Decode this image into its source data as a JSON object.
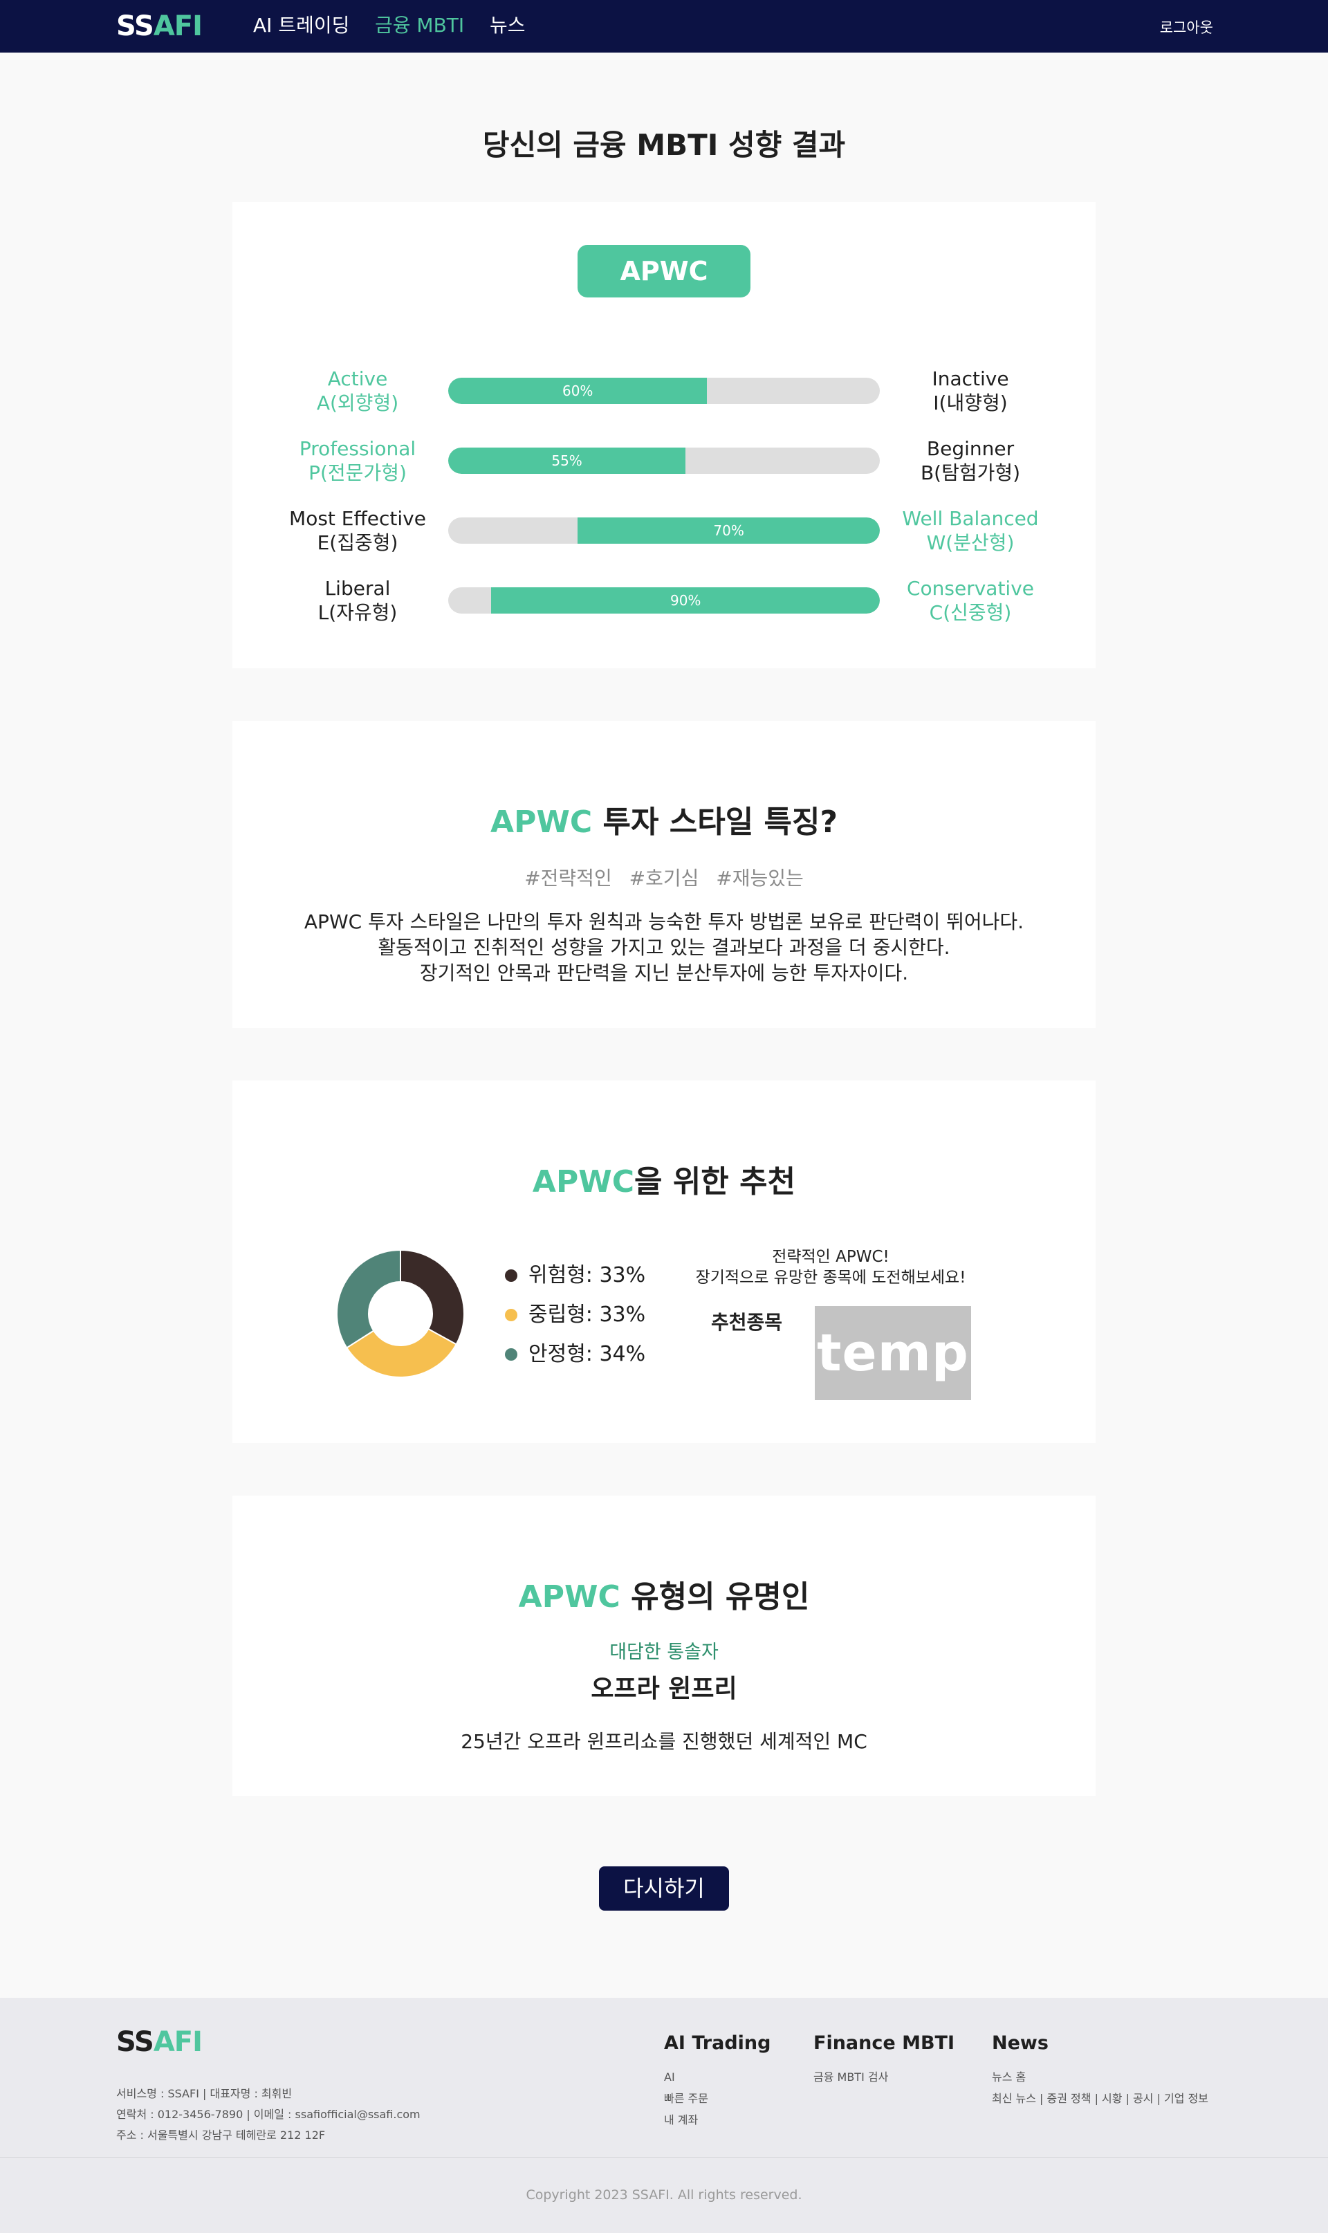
{
  "nav": {
    "logo_main": "SS",
    "logo_accent": "AFI",
    "links": [
      "AI 트레이딩",
      "금융 MBTI",
      "뉴스"
    ],
    "logout": "로그아웃"
  },
  "page_title": "당신의 금융 MBTI 성향 결과",
  "result": {
    "type": "APWC",
    "traits": [
      {
        "left_en": "Active",
        "left_ko": "A(외향형)",
        "right_en": "Inactive",
        "right_ko": "I(내향형)",
        "percent": 60,
        "percent_label": "60%",
        "winner": "left"
      },
      {
        "left_en": "Professional",
        "left_ko": "P(전문가형)",
        "right_en": "Beginner",
        "right_ko": "B(탐험가형)",
        "percent": 55,
        "percent_label": "55%",
        "winner": "left"
      },
      {
        "left_en": "Most Effective",
        "left_ko": "E(집중형)",
        "right_en": "Well Balanced",
        "right_ko": "W(분산형)",
        "percent": 70,
        "percent_label": "70%",
        "winner": "right"
      },
      {
        "left_en": "Liberal",
        "left_ko": "L(자유형)",
        "right_en": "Conservative",
        "right_ko": "C(신중형)",
        "percent": 90,
        "percent_label": "90%",
        "winner": "right"
      }
    ]
  },
  "style": {
    "title_hl": "APWC",
    "title_rest": " 투자 스타일 특징?",
    "tags": [
      "#전략적인",
      "#호기심",
      "#재능있는"
    ],
    "desc_lines": [
      "APWC 투자 스타일은 나만의 투자 원칙과 능숙한 투자 방법론 보유로 판단력이 뛰어나다.",
      "활동적이고 진취적인 성향을 가지고 있는 결과보다 과정을 더 중시한다.",
      "장기적인 안목과 판단력을 지닌 분산투자에 능한 투자자이다."
    ]
  },
  "recommend": {
    "title_hl": "APWC",
    "title_rest": "을 위한 추천",
    "portfolio": [
      {
        "label": "위험형: 33%",
        "value": 33,
        "color": "#3a2a28"
      },
      {
        "label": "중립형: 33%",
        "value": 33,
        "color": "#f6bf4f"
      },
      {
        "label": "안정형: 34%",
        "value": 34,
        "color": "#508478"
      }
    ],
    "message_line1": "전략적인 APWC!",
    "message_line2": "장기적으로 유망한 종목에 도전해보세요!",
    "stock_label": "추천종목",
    "image_text": "temp"
  },
  "celeb": {
    "title_hl": "APWC",
    "title_rest": " 유형의 유명인",
    "subtitle": "대담한 통솔자",
    "name": "오프라 윈프리",
    "desc": "25년간 오프라 윈프리쇼를 진행했던 세계적인 MC"
  },
  "retry": "다시하기",
  "footer": {
    "logo_main": "SS",
    "logo_accent": "AFI",
    "info": [
      "서비스명 : SSAFI | 대표자명 : 최휘빈",
      "연락처 : 012-3456-7890 | 이메일 : ssafiofficial@ssafi.com",
      "주소 : 서울특별시 강남구 테헤란로 212 12F"
    ],
    "columns": [
      {
        "title": "AI Trading",
        "links": [
          "AI",
          "빠른 주문",
          "내 계좌"
        ]
      },
      {
        "title": "Finance MBTI",
        "links": [
          "금융 MBTI 검사"
        ]
      },
      {
        "title": "News",
        "links": [
          "뉴스 홈",
          "최신 뉴스 | 증권 정책 | 시황 | 공시 | 기업 정보"
        ]
      }
    ],
    "copyright": "Copyright 2023 SSAFI. All rights reserved."
  },
  "colors": {
    "navy": "#0c1244",
    "accent": "#4fc69e",
    "bar_bg": "#dedede"
  }
}
